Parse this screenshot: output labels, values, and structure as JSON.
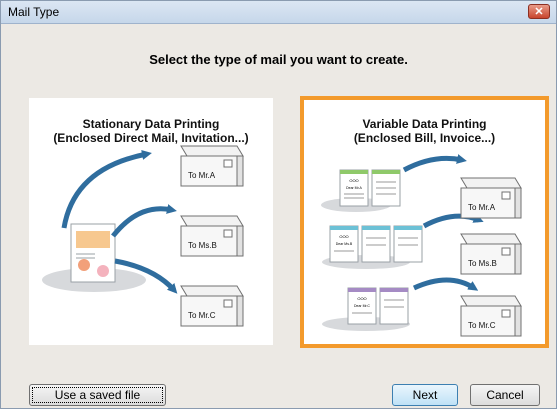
{
  "window": {
    "title": "Mail Type",
    "close_symbol": "✕"
  },
  "heading": "Select the type of mail you want to create.",
  "options": {
    "stationary": {
      "title_line1": "Stationary Data Printing",
      "title_line2": "(Enclosed Direct Mail, Invitation...)",
      "recipients": [
        "To Mr.A",
        "To Ms.B",
        "To Mr.C"
      ]
    },
    "variable": {
      "title_line1": "Variable Data Printing",
      "title_line2": "(Enclosed Bill, Invoice...)",
      "recipients": [
        "To Mr.A",
        "To Ms.B",
        "To Mr.C"
      ],
      "doc_headers": [
        "OOO",
        "OOO",
        "OOO"
      ],
      "doc_salutations": [
        "Dear Mr.A",
        "Dear Ms.B",
        "Dear Mr.C"
      ]
    }
  },
  "buttons": {
    "use_saved": "Use a saved file",
    "next": "Next",
    "cancel": "Cancel"
  },
  "colors": {
    "selection_border": "#f39a2c",
    "arrow": "#2f6d9e",
    "accent_a": "#8fc96a",
    "accent_b": "#6cc1d6",
    "accent_c": "#a58bc4"
  }
}
